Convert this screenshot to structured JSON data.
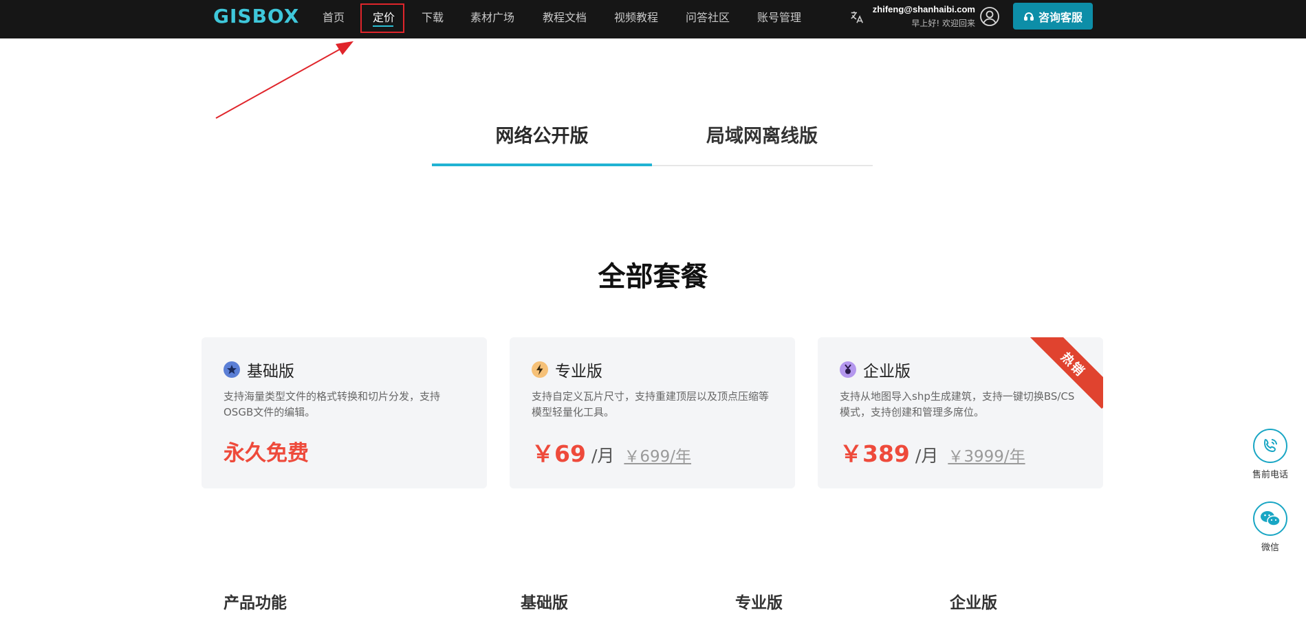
{
  "header": {
    "logo": "GISBOX",
    "nav": [
      {
        "label": "首页"
      },
      {
        "label": "定价",
        "active": true
      },
      {
        "label": "下载"
      },
      {
        "label": "素材广场"
      },
      {
        "label": "教程文档"
      },
      {
        "label": "视频教程"
      },
      {
        "label": "问答社区"
      },
      {
        "label": "账号管理"
      }
    ],
    "user_email": "zhifeng@shanhaibi.com",
    "greeting": "早上好! 欢迎回来",
    "consult_label": "咨询客服"
  },
  "tabs": [
    {
      "label": "网络公开版",
      "active": true
    },
    {
      "label": "局域网离线版"
    }
  ],
  "section_title": "全部套餐",
  "plans": [
    {
      "title": "基础版",
      "icon": "star-icon",
      "desc": "支持海量类型文件的格式转换和切片分发，支持OSGB文件的编辑。",
      "price_free": "永久免费"
    },
    {
      "title": "专业版",
      "icon": "lightning-icon",
      "desc": "支持自定义瓦片尺寸，支持重建顶层以及顶点压缩等模型轻量化工具。",
      "price": "￥69",
      "per": "/月",
      "orig": "￥699/年"
    },
    {
      "title": "企业版",
      "icon": "medal-icon",
      "desc": "支持从地图导入shp生成建筑，支持一键切换BS/CS模式，支持创建和管理多席位。",
      "price": "￥389",
      "per": "/月",
      "orig": "￥3999/年",
      "ribbon": "热销"
    }
  ],
  "compare_headers": [
    "产品功能",
    "基础版",
    "专业版",
    "企业版"
  ],
  "float": {
    "phone_label": "售前电话",
    "wechat_label": "微信"
  },
  "colors": {
    "accent": "#21b3d3",
    "price_red": "#ee4a3b",
    "topbar": "#161616",
    "consult_btn": "#0d8ea8"
  }
}
